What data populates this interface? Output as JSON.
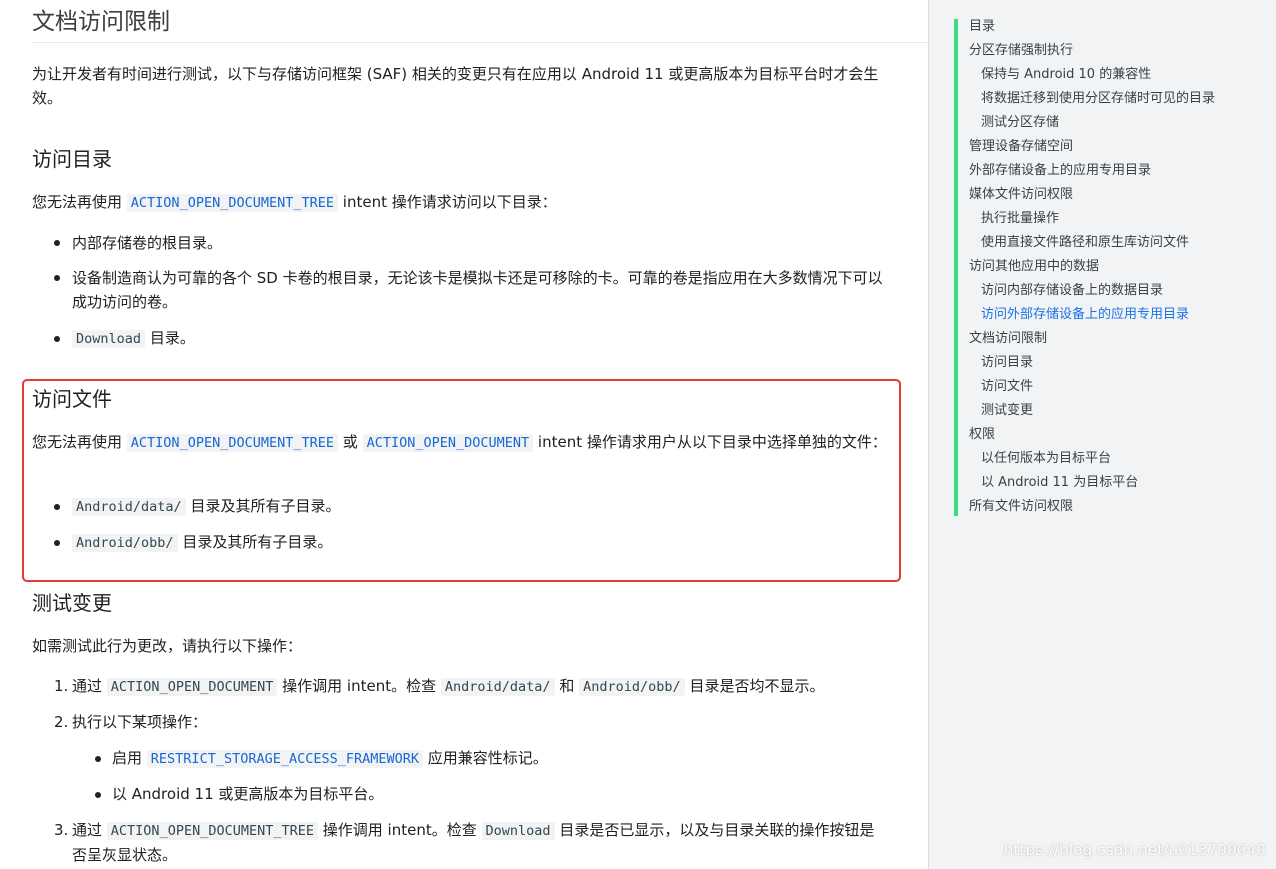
{
  "article": {
    "section_title": "文档访问限制",
    "intro": "为让开发者有时间进行测试，以下与存储访问框架 (SAF) 相关的变更只有在应用以 Android 11 或更高版本为目标平台时才会生效。",
    "dirs": {
      "heading": "访问目录",
      "text_pre": "您无法再使用",
      "code": "ACTION_OPEN_DOCUMENT_TREE",
      "text_post": "intent 操作请求访问以下目录：",
      "items": [
        "内部存储卷的根目录。",
        "设备制造商认为可靠的各个 SD 卡卷的根目录，无论该卡是模拟卡还是可移除的卡。可靠的卷是指应用在大多数情况下可以成功访问的卷。"
      ],
      "download_code": "Download",
      "download_text": "目录。"
    },
    "files": {
      "heading": "访问文件",
      "text_pre": "您无法再使用",
      "code1": "ACTION_OPEN_DOCUMENT_TREE",
      "text_or": "或",
      "code2": "ACTION_OPEN_DOCUMENT",
      "text_post": "intent 操作请求用户从以下目录中选择单独的文件：",
      "items": [
        {
          "code": "Android/data/",
          "text": "目录及其所有子目录。"
        },
        {
          "code": "Android/obb/",
          "text": "目录及其所有子目录。"
        }
      ]
    },
    "test": {
      "heading": "测试变更",
      "intro": "如需测试此行为更改，请执行以下操作：",
      "step1": {
        "num": "1.",
        "pre": "通过",
        "code1": "ACTION_OPEN_DOCUMENT",
        "mid": "操作调用 intent。检查",
        "code2": "Android/data/",
        "and": "和",
        "code3": "Android/obb/",
        "post": "目录是否均不显示。"
      },
      "step2": {
        "num": "2.",
        "text": "执行以下某项操作：",
        "sub1_pre": "启用",
        "sub1_code": "RESTRICT_STORAGE_ACCESS_FRAMEWORK",
        "sub1_post": "应用兼容性标记。",
        "sub2": "以 Android 11 或更高版本为目标平台。"
      },
      "step3": {
        "num": "3.",
        "pre": "通过",
        "code1": "ACTION_OPEN_DOCUMENT_TREE",
        "mid": "操作调用 intent。检查",
        "code2": "Download",
        "post": "目录是否已显示，以及与目录关联的操作按钮是否呈灰显状态。"
      }
    }
  },
  "toc": {
    "items": [
      {
        "label": "目录",
        "level": 1
      },
      {
        "label": "分区存储强制执行",
        "level": 1
      },
      {
        "label": "保持与 Android 10 的兼容性",
        "level": 2
      },
      {
        "label": "将数据迁移到使用分区存储时可见的目录",
        "level": 2
      },
      {
        "label": "测试分区存储",
        "level": 2
      },
      {
        "label": "管理设备存储空间",
        "level": 1
      },
      {
        "label": "外部存储设备上的应用专用目录",
        "level": 1
      },
      {
        "label": "媒体文件访问权限",
        "level": 1
      },
      {
        "label": "执行批量操作",
        "level": 2
      },
      {
        "label": "使用直接文件路径和原生库访问文件",
        "level": 2
      },
      {
        "label": "访问其他应用中的数据",
        "level": 1
      },
      {
        "label": "访问内部存储设备上的数据目录",
        "level": 2
      },
      {
        "label": "访问外部存储设备上的应用专用目录",
        "level": 2,
        "active": true
      },
      {
        "label": "文档访问限制",
        "level": 1
      },
      {
        "label": "访问目录",
        "level": 2
      },
      {
        "label": "访问文件",
        "level": 2
      },
      {
        "label": "测试变更",
        "level": 2
      },
      {
        "label": "权限",
        "level": 1
      },
      {
        "label": "以任何版本为目标平台",
        "level": 2
      },
      {
        "label": "以 Android 11 为目标平台",
        "level": 2
      },
      {
        "label": "所有文件访问权限",
        "level": 1
      }
    ],
    "accent_color": "#3ddc84",
    "active_color": "#1a73e8"
  },
  "watermark": "https://blog.csdn.net/u013700040"
}
